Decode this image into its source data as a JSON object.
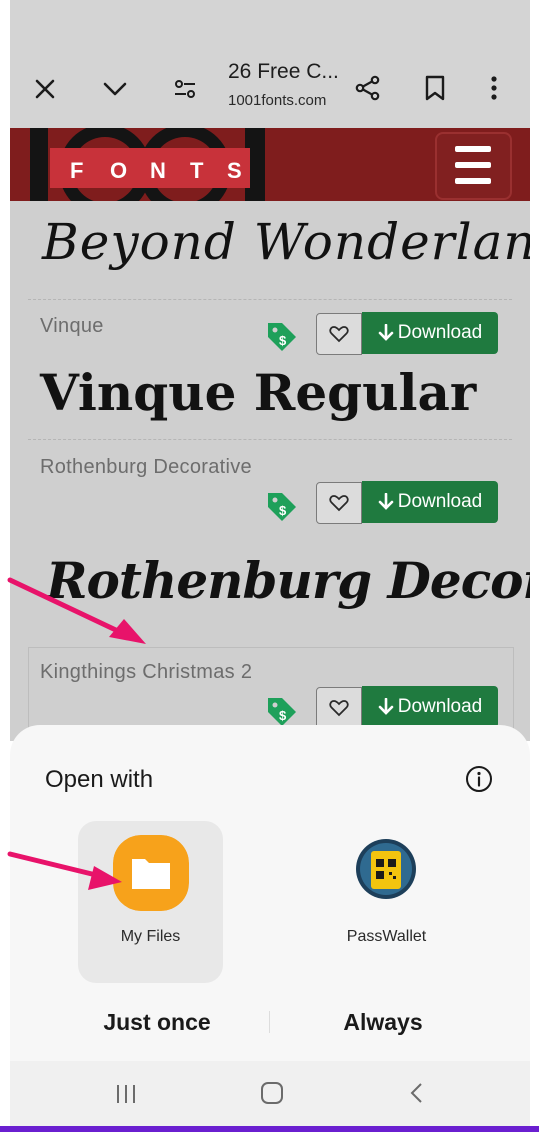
{
  "browser": {
    "title": "26 Free C...",
    "url": "1001fonts.com"
  },
  "site": {
    "logo_letters": [
      "F",
      "O",
      "N",
      "T",
      "S"
    ],
    "logo_digits": "1001"
  },
  "fonts": [
    {
      "name": "",
      "sample": "Beyond Wonderlanc"
    },
    {
      "name": "Vinque",
      "sample": "Vinque Regular",
      "download_label": "Download"
    },
    {
      "name": "Rothenburg Decorative",
      "sample": "Rothenburg Decor",
      "download_label": "Download"
    },
    {
      "name": "Kingthings Christmas 2",
      "download_label": "Download"
    }
  ],
  "sheet": {
    "title": "Open with",
    "apps": [
      {
        "label": "My Files",
        "icon": "folder-icon",
        "color": "#f7a21b"
      },
      {
        "label": "PassWallet",
        "icon": "passwallet-icon",
        "color": "#f2c40f"
      }
    ],
    "just_once_label": "Just once",
    "always_label": "Always"
  },
  "colors": {
    "site_header": "#7f1d1d",
    "download_button": "#1f7a3f",
    "annotation_arrow": "#e8136a",
    "bottom_border": "#6a1fd0"
  },
  "nav_icons": [
    "recent-apps-icon",
    "home-icon",
    "back-icon"
  ]
}
